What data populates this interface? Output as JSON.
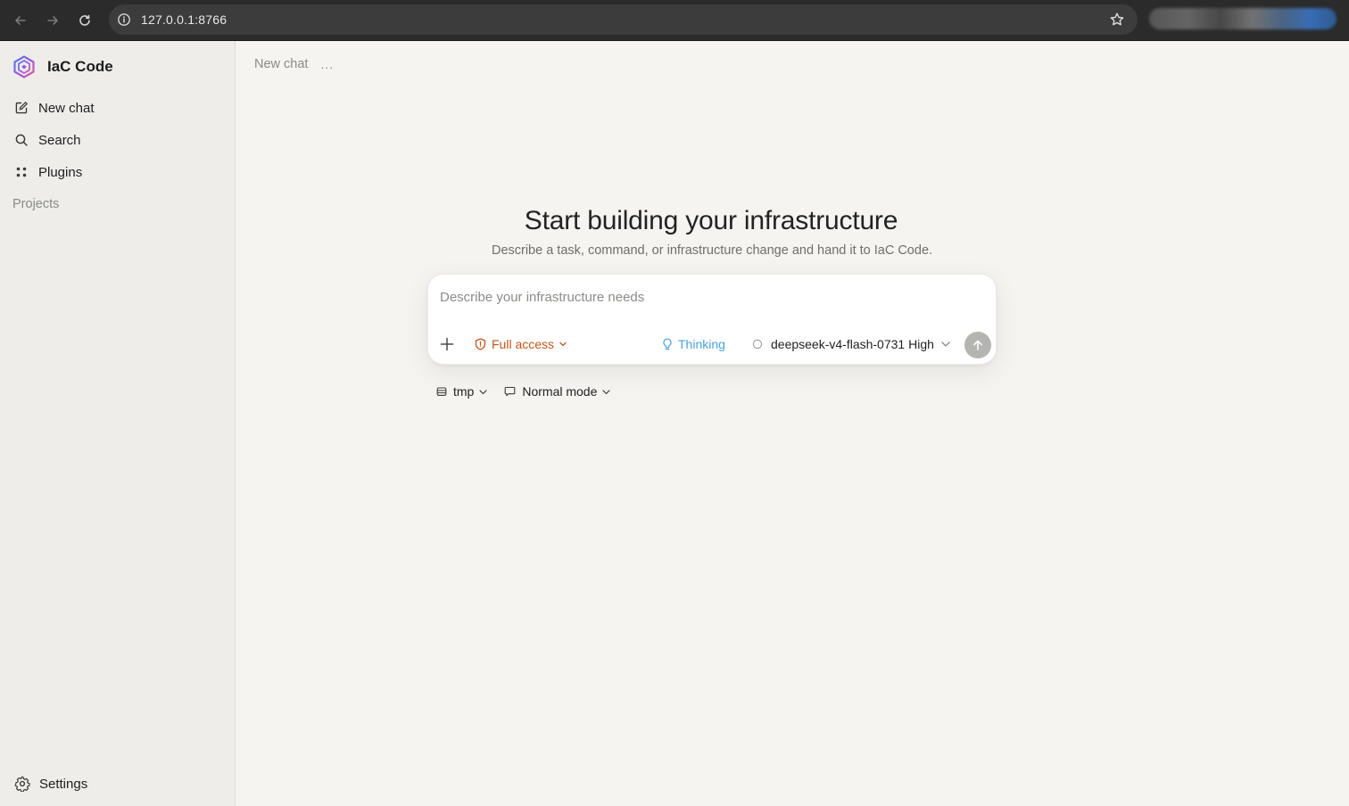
{
  "browser": {
    "url": "127.0.0.1:8766"
  },
  "sidebar": {
    "app_name": "IaC Code",
    "items": [
      {
        "label": "New chat",
        "icon": "compose-icon"
      },
      {
        "label": "Search",
        "icon": "search-icon"
      },
      {
        "label": "Plugins",
        "icon": "plugins-icon"
      }
    ],
    "section_label": "Projects",
    "settings_label": "Settings"
  },
  "main": {
    "chat_title": "New chat",
    "more_label": "...",
    "hero_title": "Start building your infrastructure",
    "hero_subtitle": "Describe a task, command, or infrastructure change and hand it to IaC Code.",
    "composer": {
      "placeholder": "Describe your infrastructure needs",
      "access_label": "Full access",
      "thinking_label": "Thinking",
      "model_label": "deepseek-v4-flash-0731 High"
    },
    "workspace_label": "tmp",
    "mode_label": "Normal mode"
  },
  "colors": {
    "access": "#c0561a",
    "thinking": "#4aa3df",
    "send_disabled": "#b4b4b1",
    "sidebar_bg": "#eeede9",
    "main_bg": "#f5f4f1"
  }
}
